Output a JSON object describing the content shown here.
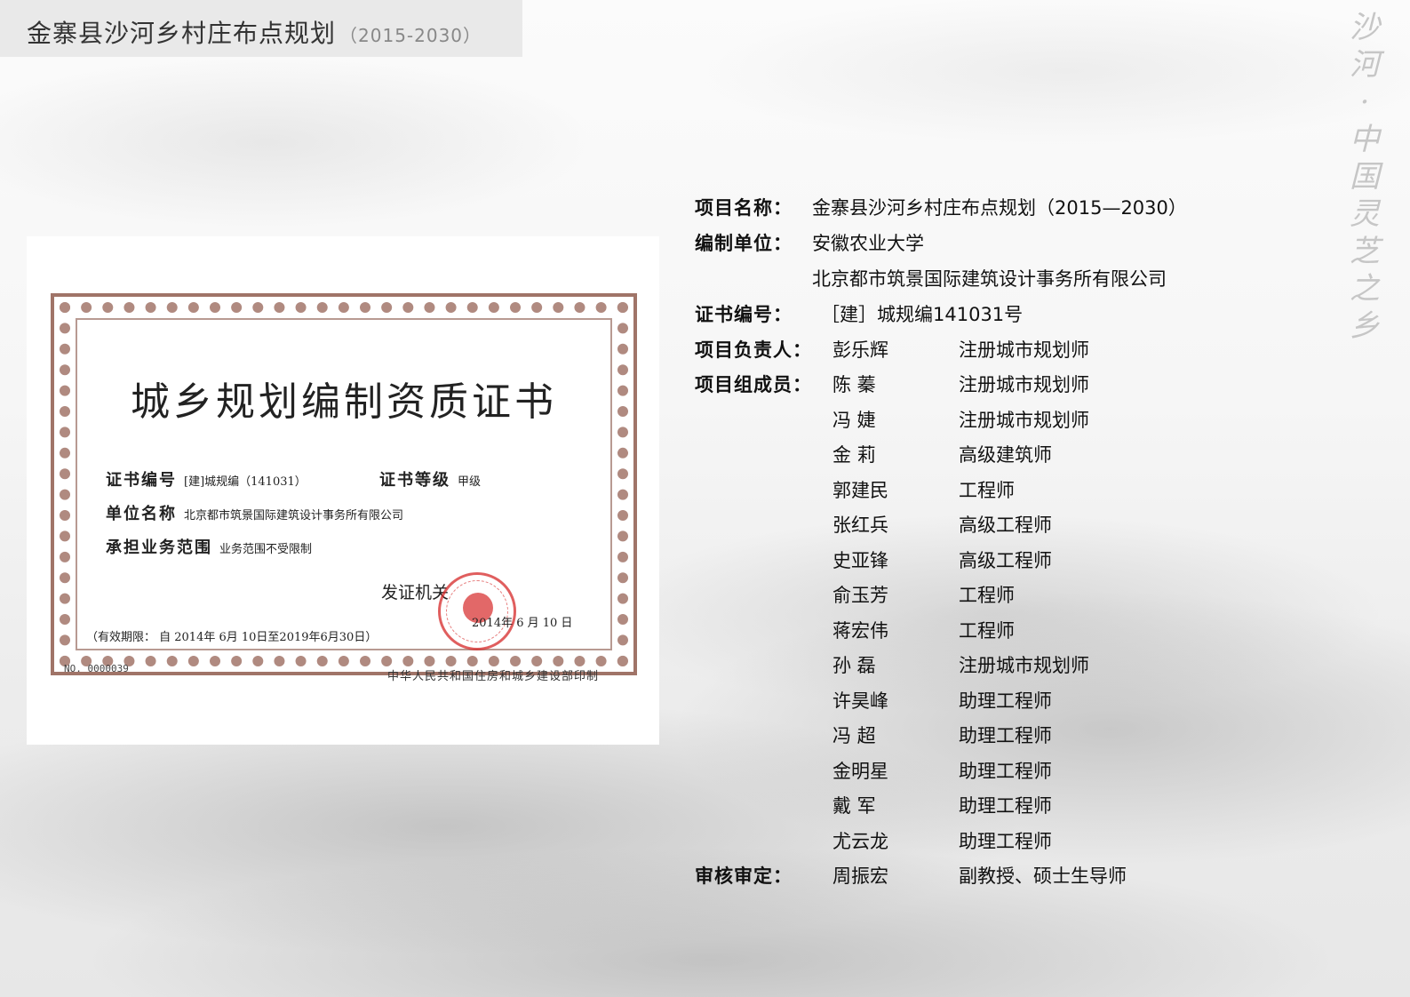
{
  "header": {
    "title": "金寨县沙河乡村庄布点规划",
    "subtitle": "（2015-2030）"
  },
  "brand_vertical": [
    "沙",
    "河",
    "·",
    "中",
    "国",
    "灵",
    "芝",
    "之",
    "乡"
  ],
  "certificate": {
    "title": "城乡规划编制资质证书",
    "cert_no_label": "证书编号",
    "cert_no_value": "[建]城规编（141031）",
    "grade_label": "证书等级",
    "grade_value": "甲级",
    "unit_label": "单位名称",
    "unit_value": "北京都市筑景国际建筑设计事务所有限公司",
    "scope_label": "承担业务范围",
    "scope_value": "业务范围不受限制",
    "issuer_label": "发证机关",
    "issue_date": "2014年 6 月 10 日",
    "validity": "（有效期限： 自 2014年 6月 10日至2019年6月30日）",
    "serial_no": "NO. 0000039",
    "printer": "中华人民共和国住房和城乡建设部印制"
  },
  "info": {
    "project_name_label": "项目名称：",
    "project_name_value": "金寨县沙河乡村庄布点规划（2015—2030）",
    "org_label": "编制单位：",
    "org_values": [
      "安徽农业大学",
      "北京都市筑景国际建筑设计事务所有限公司"
    ],
    "cert_label": "证书编号：",
    "cert_value": "［建］城规编141031号",
    "leader_label": "项目负责人：",
    "leader": {
      "name": "彭乐辉",
      "title": "注册城市规划师"
    },
    "members_label": "项目组成员：",
    "members": [
      {
        "name": "陈  蓁",
        "title": "注册城市规划师"
      },
      {
        "name": "冯  婕",
        "title": "注册城市规划师"
      },
      {
        "name": "金  莉",
        "title": "高级建筑师"
      },
      {
        "name": "郭建民",
        "title": "工程师"
      },
      {
        "name": "张红兵",
        "title": "高级工程师"
      },
      {
        "name": "史亚锋",
        "title": "高级工程师"
      },
      {
        "name": "俞玉芳",
        "title": "工程师"
      },
      {
        "name": "蒋宏伟",
        "title": "工程师"
      },
      {
        "name": "孙  磊",
        "title": "注册城市规划师"
      },
      {
        "name": "许昊峰",
        "title": "助理工程师"
      },
      {
        "name": "冯  超",
        "title": "助理工程师"
      },
      {
        "name": "金明星",
        "title": "助理工程师"
      },
      {
        "name": "戴  军",
        "title": "助理工程师"
      },
      {
        "name": "尤云龙",
        "title": "助理工程师"
      }
    ],
    "reviewer_label": "审核审定：",
    "reviewer": {
      "name": "周振宏",
      "title": "副教授、硕士生导师"
    }
  }
}
